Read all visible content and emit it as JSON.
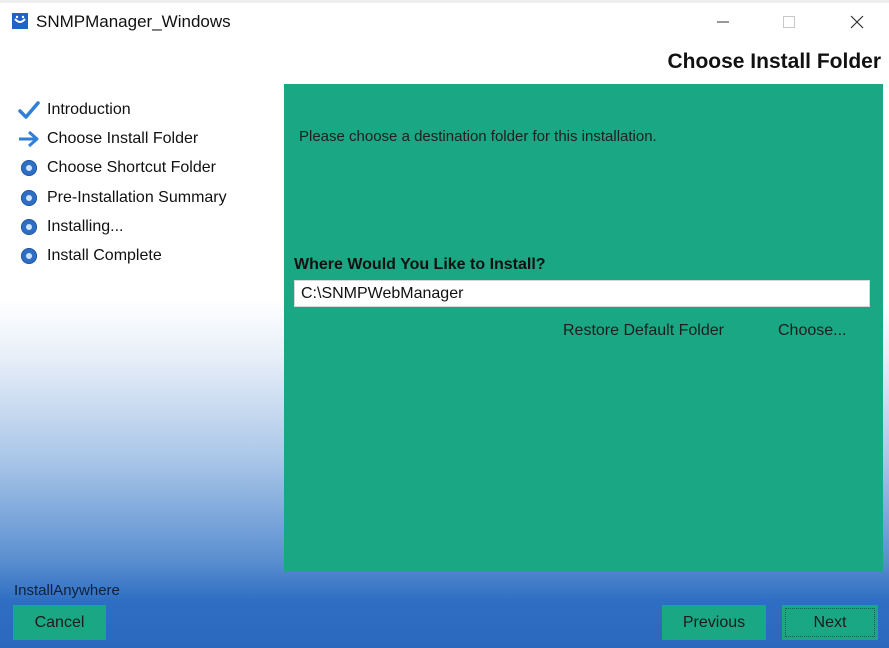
{
  "window": {
    "title": "SNMPManager_Windows",
    "controls": [
      "minimize-icon",
      "maximize-icon",
      "close-icon"
    ]
  },
  "header": {
    "step_title": "Choose Install Folder"
  },
  "steps": [
    {
      "label": "Introduction",
      "state": "done",
      "icon": "checkmark-icon"
    },
    {
      "label": "Choose Install Folder",
      "state": "current",
      "icon": "arrow-right-icon"
    },
    {
      "label": "Choose Shortcut Folder",
      "state": "pending",
      "icon": "bullet-icon"
    },
    {
      "label": "Pre-Installation Summary",
      "state": "pending",
      "icon": "bullet-icon"
    },
    {
      "label": "Installing...",
      "state": "pending",
      "icon": "bullet-icon"
    },
    {
      "label": "Install Complete",
      "state": "pending",
      "icon": "bullet-icon"
    }
  ],
  "main": {
    "intro": "Please choose a destination folder for this installation.",
    "where_label": "Where Would You Like to Install?",
    "install_path": "C:\\SNMPWebManager",
    "restore_label": "Restore Default Folder",
    "choose_label": "Choose..."
  },
  "footer": {
    "brand": "InstallAnywhere",
    "cancel_label": "Cancel",
    "previous_label": "Previous",
    "next_label": "Next"
  },
  "colors": {
    "panel": "#1aa784",
    "accent_blue": "#2f6fc3",
    "check_blue": "#2f7fd6"
  }
}
